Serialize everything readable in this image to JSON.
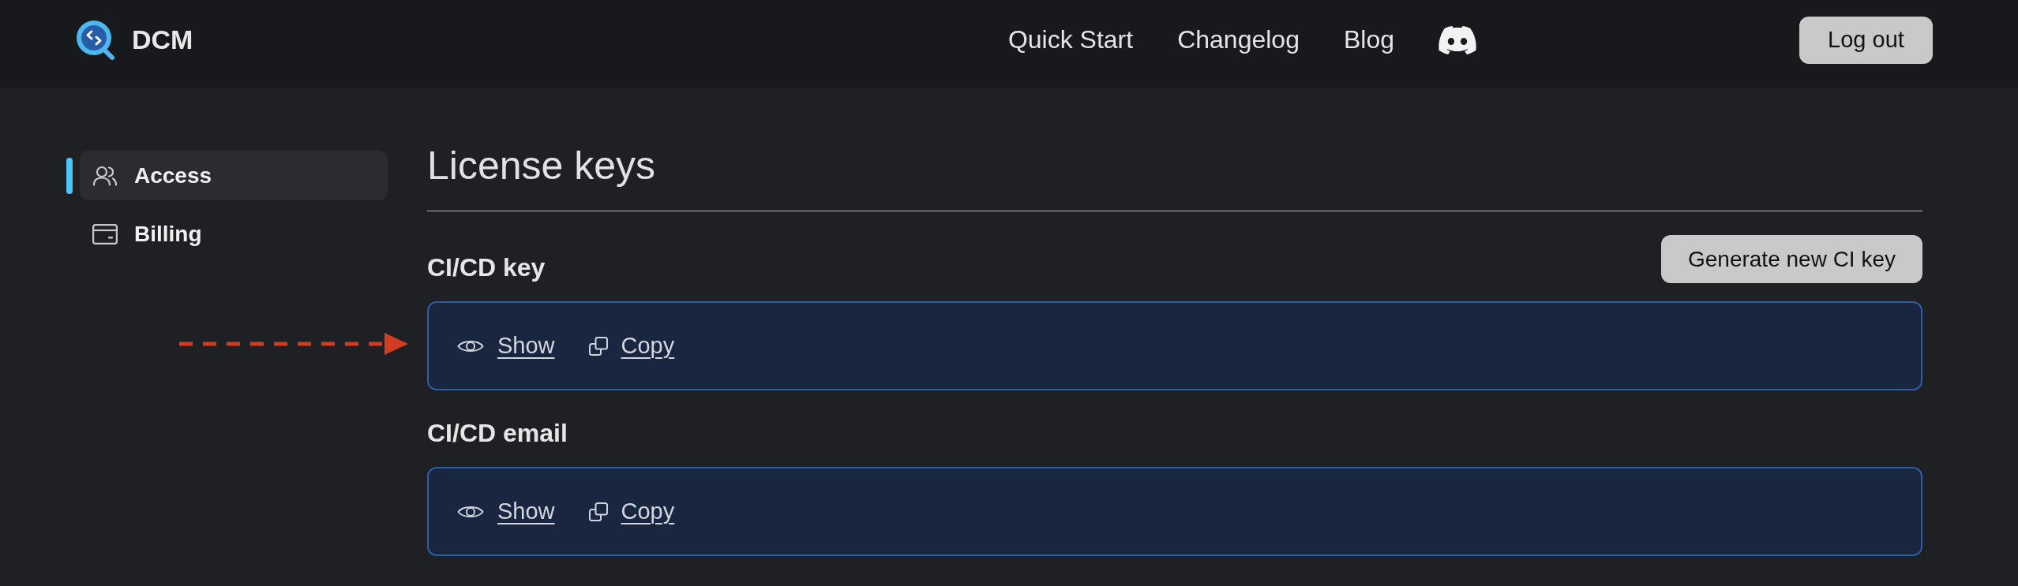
{
  "header": {
    "brand": "DCM",
    "nav_links": [
      "Quick Start",
      "Changelog",
      "Blog"
    ],
    "logout_button": "Log out"
  },
  "sidebar": {
    "items": [
      {
        "label": "Access",
        "selected": true
      },
      {
        "label": "Billing",
        "selected": false
      }
    ]
  },
  "page": {
    "title": "License keys",
    "sections": [
      {
        "heading": "CI/CD key",
        "button": "Generate new CI key",
        "actions": [
          "Show",
          "Copy"
        ]
      },
      {
        "heading": "CI/CD email",
        "actions": [
          "Show",
          "Copy"
        ]
      }
    ]
  }
}
